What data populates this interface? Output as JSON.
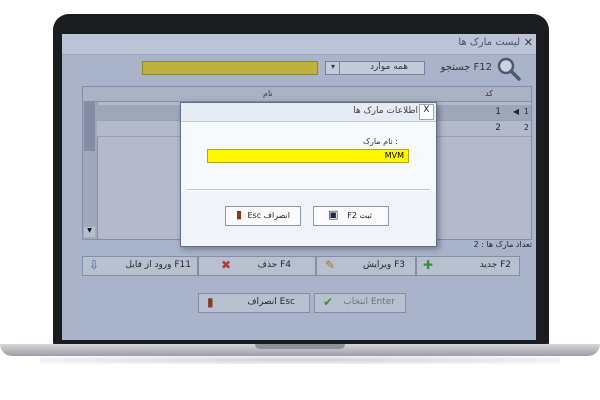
{
  "window": {
    "title": "لیست مارک ها",
    "close_glyph": "✕"
  },
  "search": {
    "label": "جستجو F12",
    "filter_value": "همه موارد",
    "filter_arrow": "▾",
    "query": ""
  },
  "grid": {
    "headers": {
      "name": "نام",
      "code": "کد"
    },
    "rows": [
      {
        "index": "1",
        "pointer": "◀",
        "code": "1",
        "name": ""
      },
      {
        "index": "2",
        "pointer": "",
        "code": "2",
        "name": ""
      }
    ],
    "scroll_up": "▲",
    "scroll_down": "▼"
  },
  "count_label": "تعداد مارک ها : 2",
  "buttons": {
    "new": "جدید F2",
    "edit": "ویرایش F3",
    "delete": "حذف F4",
    "import": "ورود از فایل F11",
    "select": "انتخاب Enter",
    "cancel": "انصراف Esc"
  },
  "icons": {
    "new": "✚",
    "edit": "✎",
    "delete": "✖",
    "import": "⇩",
    "select": "✔",
    "cancel": "▮",
    "new_color": "#2f9a2f",
    "delete_color": "#c0392b",
    "select_color": "#2f9a2f"
  },
  "dialog": {
    "title": "اطلاعات مارک ها",
    "close_glyph": "X",
    "field_label": "نام مارک :",
    "field_value": "MVM",
    "save_label": "F2 ثبت",
    "cancel_label": "Esc انصراف",
    "save_icon": "▣",
    "cancel_icon": "▮"
  },
  "colors": {
    "highlight_input": "#fff600",
    "search_box": "#cdbf3a"
  }
}
